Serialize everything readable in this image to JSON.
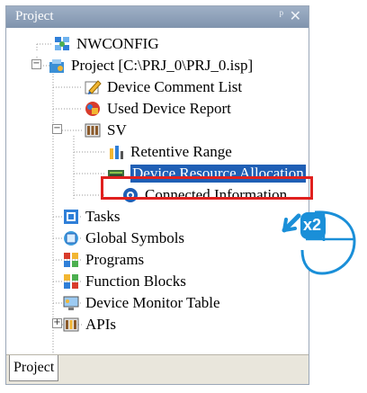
{
  "panel": {
    "title": "Project"
  },
  "tree": {
    "nwconfig": "NWCONFIG",
    "project": "Project [C:\\PRJ_0\\PRJ_0.isp]",
    "device_comment_list": "Device Comment List",
    "used_device_report": "Used Device Report",
    "sv": "SV",
    "retentive_range": "Retentive Range",
    "device_resource_allocation": "Device Resource Allocation",
    "connected_information": "Connected Information",
    "tasks": "Tasks",
    "global_symbols": "Global Symbols",
    "programs": "Programs",
    "function_blocks": "Function Blocks",
    "device_monitor_table": "Device Monitor Table",
    "apis": "APIs"
  },
  "tabs": {
    "project": "Project"
  },
  "annotation": {
    "double_click_badge": "x2"
  },
  "colors": {
    "highlight": "#1f5fb5",
    "callout_red": "#e0201e",
    "badge_blue": "#1a8fd8"
  }
}
